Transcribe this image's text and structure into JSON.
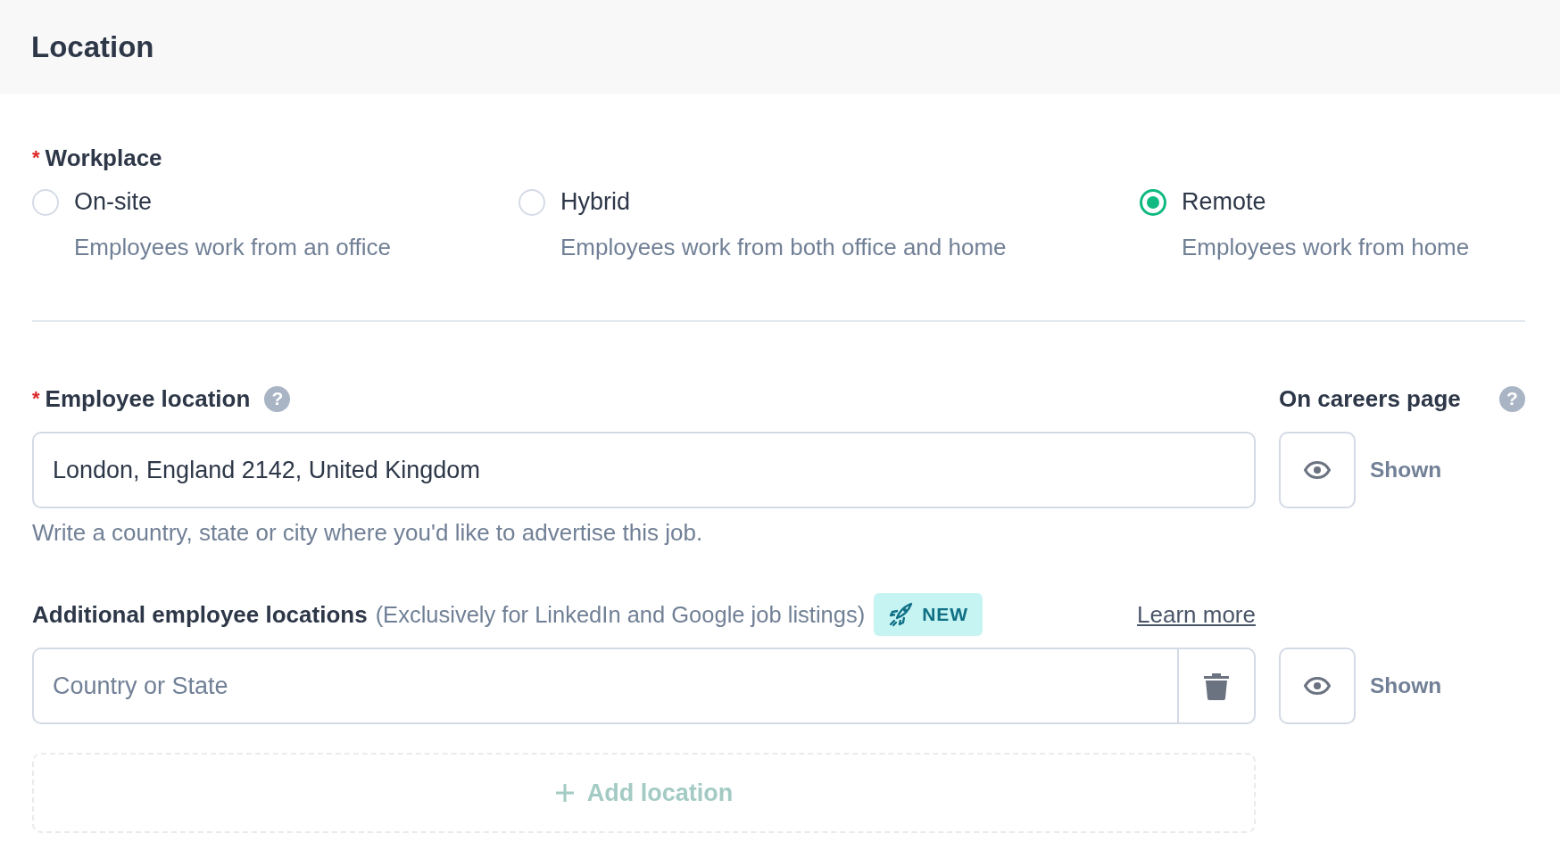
{
  "section": {
    "title": "Location"
  },
  "workplace": {
    "required_mark": "*",
    "label": "Workplace",
    "options": [
      {
        "label": "On-site",
        "description": "Employees work from an office",
        "selected": false
      },
      {
        "label": "Hybrid",
        "description": "Employees work from both office and home",
        "selected": false
      },
      {
        "label": "Remote",
        "description": "Employees work from home",
        "selected": true
      }
    ]
  },
  "employee_location": {
    "required_mark": "*",
    "label": "Employee location",
    "help": "?",
    "value": "London, England 2142, United Kingdom",
    "hint": "Write a country, state or city where you'd like to advertise this job.",
    "visibility": "Shown"
  },
  "careers_page": {
    "label": "On careers page",
    "help": "?"
  },
  "additional_locations": {
    "label": "Additional employee locations",
    "note": "(Exclusively for LinkedIn and Google job listings)",
    "badge": "NEW",
    "link": "Learn more",
    "placeholder": "Country or State",
    "visibility": "Shown",
    "add_button": "Add location"
  }
}
